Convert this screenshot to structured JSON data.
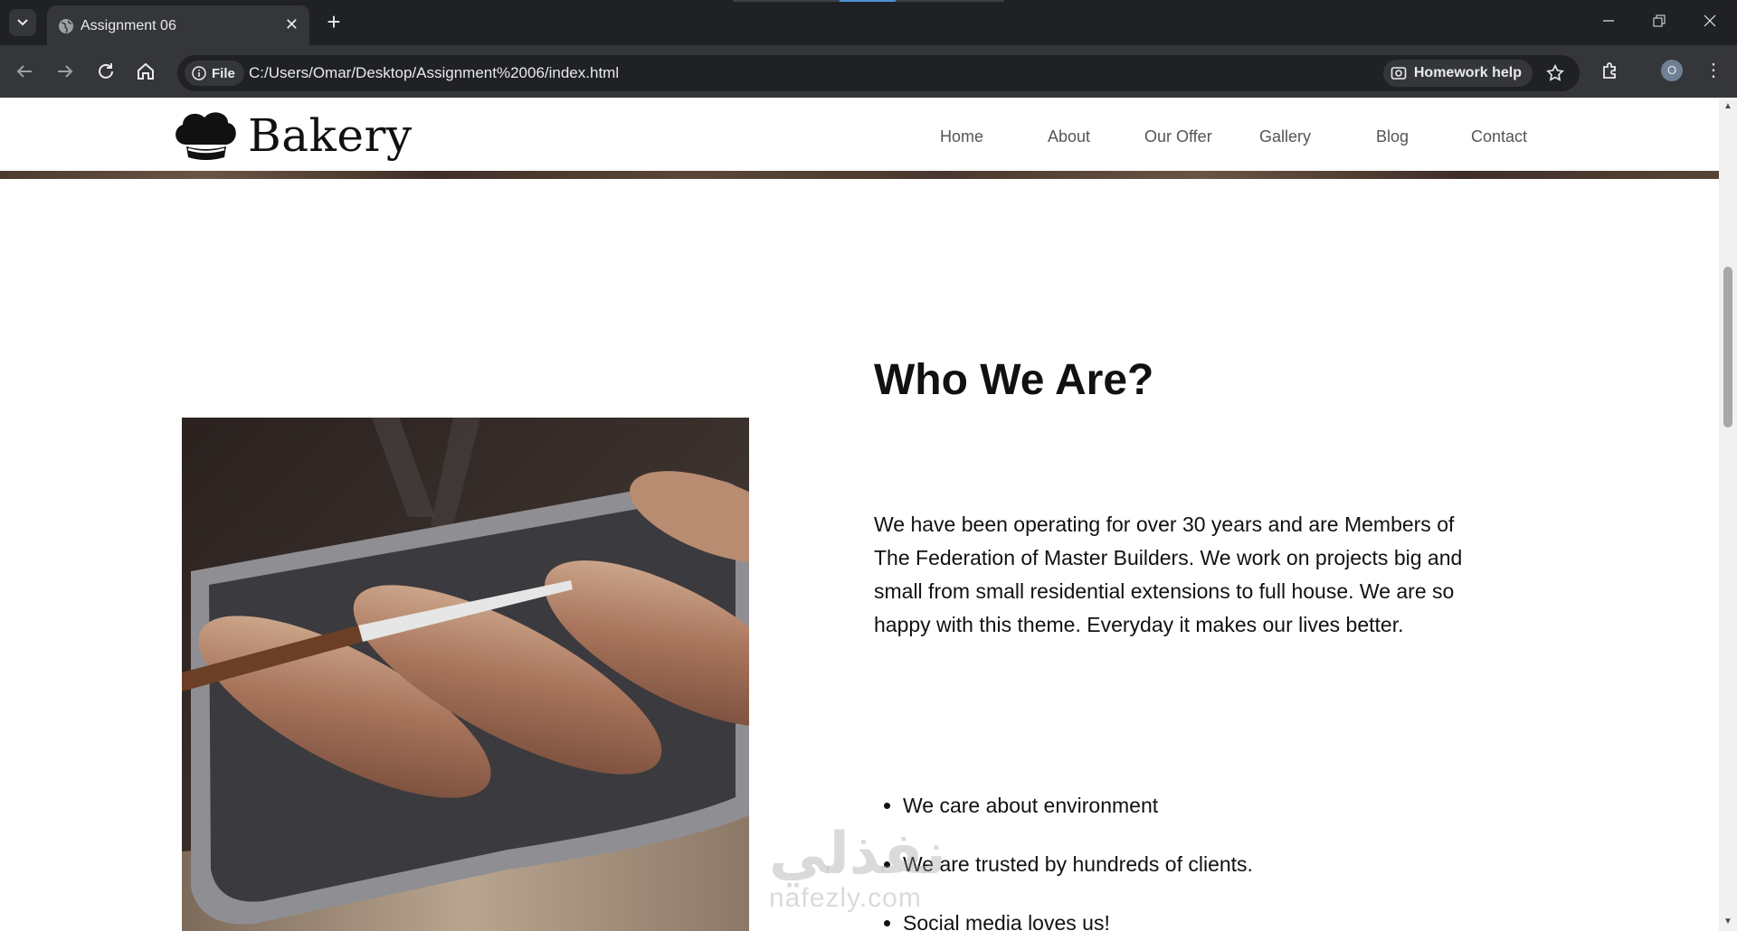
{
  "browser": {
    "tab_title": "Assignment 06",
    "address_chip": "File",
    "url": "C:/Users/Omar/Desktop/Assignment%2006/index.html",
    "homework_help": "Homework help",
    "profile_initial": "O"
  },
  "site": {
    "brand": "Bakery",
    "nav": [
      "Home",
      "About",
      "Our Offer",
      "Gallery",
      "Blog",
      "Contact"
    ]
  },
  "about": {
    "title": "Who We Are?",
    "paragraph": "We have been operating for over 30 years and are Members of The Federation of Master Builders. We work on projects big and small from small residential extensions to full house. We are so happy with this theme. Everyday it makes our lives better.",
    "list": [
      "We care about environment",
      "We are trusted by hundreds of clients.",
      "Social media loves us!"
    ]
  },
  "watermark": {
    "arabic": "نفذلي",
    "latin": "nafezly.com"
  },
  "icons": {
    "tab_search": "chevron-down-icon",
    "favicon": "globe-icon",
    "back": "back-arrow-icon",
    "forward": "forward-arrow-icon",
    "reload": "reload-icon",
    "home": "home-icon",
    "info": "info-icon",
    "homework": "camera-search-icon",
    "bookmark": "star-icon",
    "extensions": "puzzle-icon",
    "menu": "more-vert-icon",
    "logo": "chef-hat-icon"
  },
  "colors": {
    "chrome_dark": "#202124",
    "chrome_mid": "#35363a",
    "page_bg": "#ffffff",
    "text": "#111111",
    "nav_text": "#555555"
  }
}
